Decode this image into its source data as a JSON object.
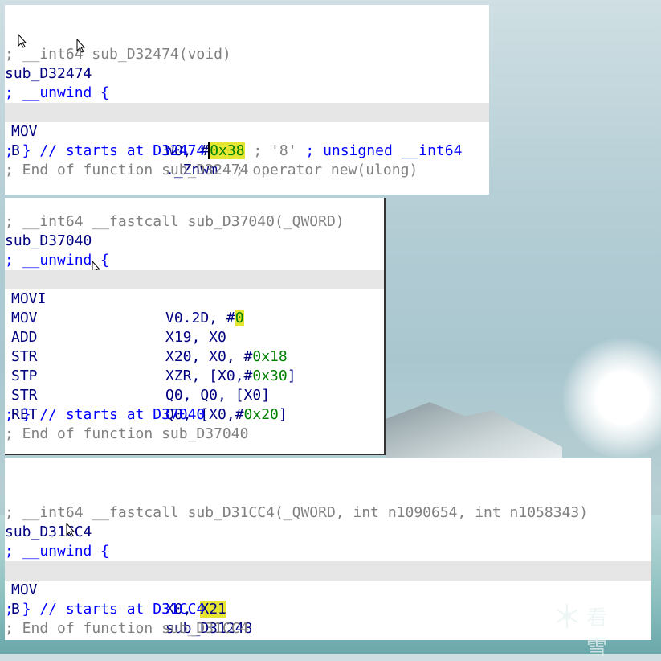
{
  "panel1": {
    "comment": "; __int64 sub_D32474(void)",
    "name": "sub_D32474",
    "unwind": "; __unwind {",
    "mov_mn": "MOV",
    "mov_op_pre": "W0, #",
    "mov_op_val": "0x38",
    "mov_comment": " ; '8'",
    "mov_comment2": " ; unsigned __int64",
    "b_mn": "B",
    "b_op": "._Znwm",
    "b_comment": "  ; operator new(ulong)",
    "starts": "; } // starts at D32474",
    "end": "; End of function sub_D32474"
  },
  "panel2": {
    "comment": "; __int64 __fastcall sub_D37040(_QWORD)",
    "name": "sub_D37040",
    "unwind": "; __unwind {",
    "l1_mn": "MOVI",
    "l1_op_pre": "V0.2D, #",
    "l1_op_val": "0",
    "l2_mn": "MOV",
    "l2_op": "X19, X0",
    "l3_mn": "ADD",
    "l3_op_pre": "X20, X0, #",
    "l3_op_val": "0x18",
    "l4_mn": "STR",
    "l4_op_pre": "XZR, [X0,#",
    "l4_op_val": "0x30",
    "l4_op_post": "]",
    "l5_mn": "STP",
    "l5_op": "Q0, Q0, [X0]",
    "l6_mn": "STR",
    "l6_op_pre": "Q0, [X0,#",
    "l6_op_val": "0x20",
    "l6_op_post": "]",
    "l7_mn": "RET",
    "starts": "; } // starts at D37040",
    "end": "; End of function sub_D37040"
  },
  "panel3": {
    "comment": "; __int64 __fastcall sub_D31CC4(_QWORD, int n1090654, int n1058343)",
    "name": "sub_D31CC4",
    "unwind": "; __unwind {",
    "l1_mn": "MOV",
    "l1_op_pre": "X0, ",
    "l1_op_val": "X21",
    "l2_mn": "B",
    "l2_op": "sub_D31248",
    "starts": "; } // starts at D31CC4",
    "end": "; End of function sub_D31CC4"
  },
  "watermark": {
    "text": "看雪",
    "icon": "snowflake-icon"
  }
}
